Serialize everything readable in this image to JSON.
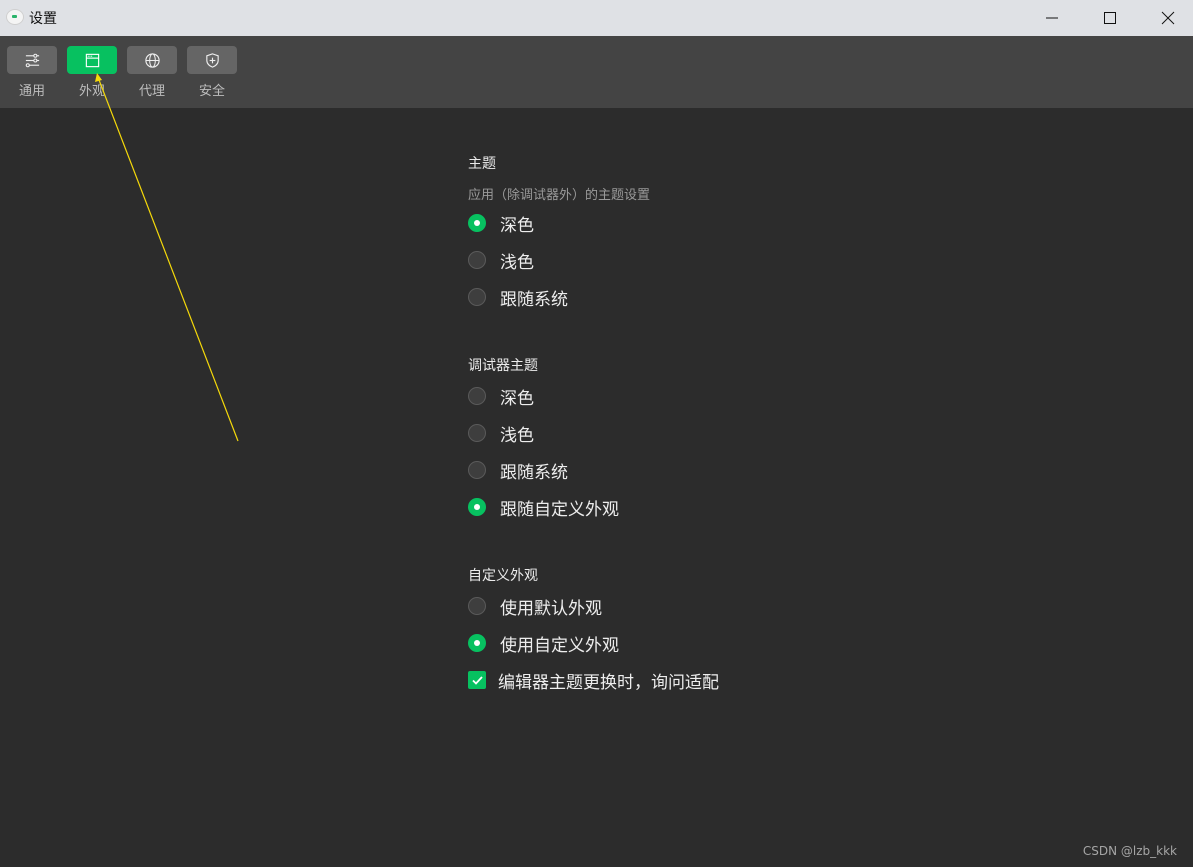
{
  "window": {
    "title": "设置",
    "controls": [
      "minimize",
      "maximize",
      "close"
    ]
  },
  "toolbar": {
    "items": [
      {
        "id": "general",
        "label": "通用",
        "icon": "sliders-icon",
        "active": false
      },
      {
        "id": "appearance",
        "label": "外观",
        "icon": "window-icon",
        "active": true
      },
      {
        "id": "proxy",
        "label": "代理",
        "icon": "globe-icon",
        "active": false
      },
      {
        "id": "security",
        "label": "安全",
        "icon": "shield-icon",
        "active": false
      }
    ]
  },
  "sections": {
    "theme": {
      "title": "主题",
      "description": "应用（除调试器外）的主题设置",
      "options": [
        {
          "label": "深色",
          "selected": true
        },
        {
          "label": "浅色",
          "selected": false
        },
        {
          "label": "跟随系统",
          "selected": false
        }
      ]
    },
    "debugger_theme": {
      "title": "调试器主题",
      "options": [
        {
          "label": "深色",
          "selected": false
        },
        {
          "label": "浅色",
          "selected": false
        },
        {
          "label": "跟随系统",
          "selected": false
        },
        {
          "label": "跟随自定义外观",
          "selected": true
        }
      ]
    },
    "custom_appearance": {
      "title": "自定义外观",
      "options": [
        {
          "label": "使用默认外观",
          "selected": false
        },
        {
          "label": "使用自定义外观",
          "selected": true
        }
      ],
      "checkbox": {
        "label": "编辑器主题更换时，询问适配",
        "checked": true
      }
    }
  },
  "colors": {
    "accent": "#07c160",
    "annotation_arrow": "#f5d90a"
  },
  "watermark": "CSDN @lzb_kkk"
}
